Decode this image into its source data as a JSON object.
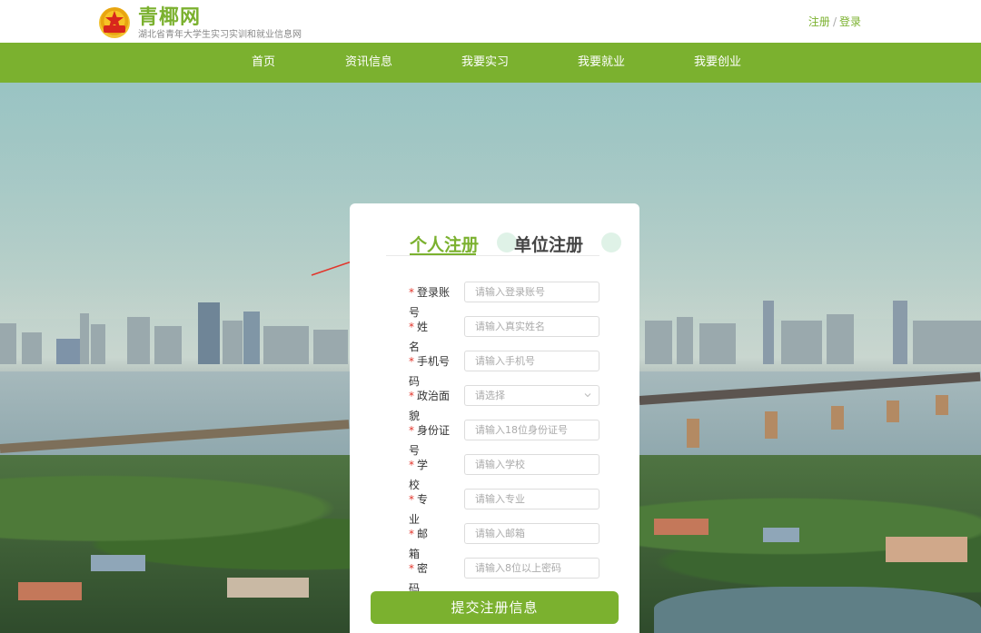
{
  "header": {
    "site_title": "青椰网",
    "site_subtitle": "湖北省青年大学生实习实训和就业信息网",
    "register_link": "注册",
    "separator": "/",
    "login_link": "登录"
  },
  "nav": {
    "items": [
      {
        "label": "首页"
      },
      {
        "label": "资讯信息"
      },
      {
        "label": "我要实习"
      },
      {
        "label": "我要就业"
      },
      {
        "label": "我要创业"
      }
    ]
  },
  "form": {
    "tab_personal": "个人注册",
    "tab_company": "单位注册",
    "required_mark": "*",
    "fields": [
      {
        "label": "登录账号",
        "placeholder": "请输入登录账号"
      },
      {
        "label": "姓名",
        "placeholder": "请输入真实姓名"
      },
      {
        "label": "手机号码",
        "placeholder": "请输入手机号"
      },
      {
        "label": "政治面貌",
        "placeholder": "请选择"
      },
      {
        "label": "身份证号",
        "placeholder": "请输入18位身份证号"
      },
      {
        "label": "学校",
        "placeholder": "请输入学校"
      },
      {
        "label": "专业",
        "placeholder": "请输入专业"
      },
      {
        "label": "邮箱",
        "placeholder": "请输入邮箱"
      },
      {
        "label": "密码",
        "placeholder": "请输入8位以上密码"
      }
    ],
    "submit_label": "提交注册信息"
  },
  "colors": {
    "brand_green": "#7bb12f",
    "required_red": "#e2352b",
    "annotation_red": "#e2352b"
  },
  "icons": {
    "logo": "youth-league-emblem-icon",
    "select_caret": "chevron-down-icon",
    "annotation": "red-arrow-icon"
  }
}
